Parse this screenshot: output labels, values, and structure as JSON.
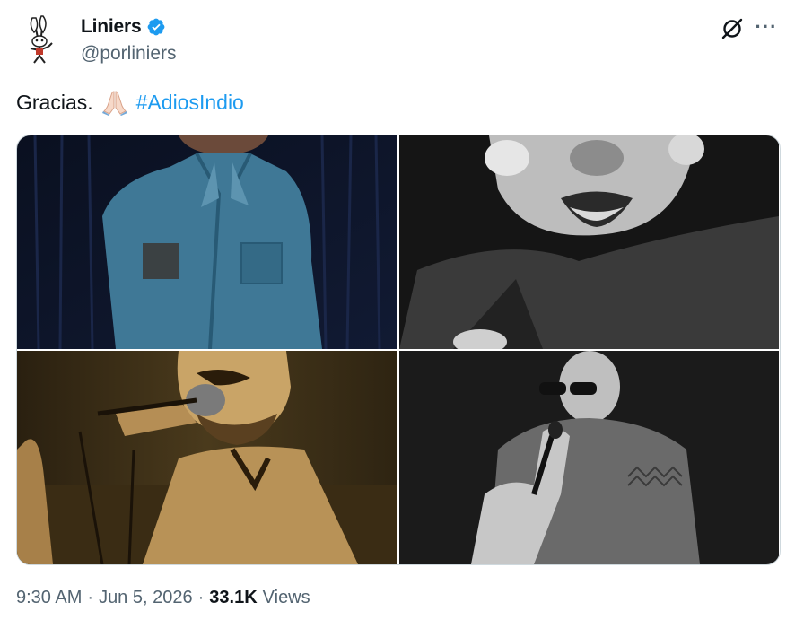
{
  "author": {
    "name": "Liniers",
    "handle": "@porliniers",
    "verified": true,
    "verified_color": "#1d9bf0"
  },
  "tweet": {
    "text": "Gracias.",
    "emoji": "folded-hands",
    "hashtag": "#AdiosIndio"
  },
  "media": [
    {
      "description": "photo-1"
    },
    {
      "description": "photo-2"
    },
    {
      "description": "photo-3"
    },
    {
      "description": "photo-4"
    }
  ],
  "meta": {
    "time": "9:30 AM",
    "separator": "·",
    "date": "Jun 5, 2026",
    "views_count": "33.1K",
    "views_label": "Views"
  },
  "icons": {
    "grok": "grok-icon",
    "more": "more-icon"
  },
  "colors": {
    "link": "#1d9bf0",
    "secondary_text": "#536471",
    "primary_text": "#0f1419"
  }
}
